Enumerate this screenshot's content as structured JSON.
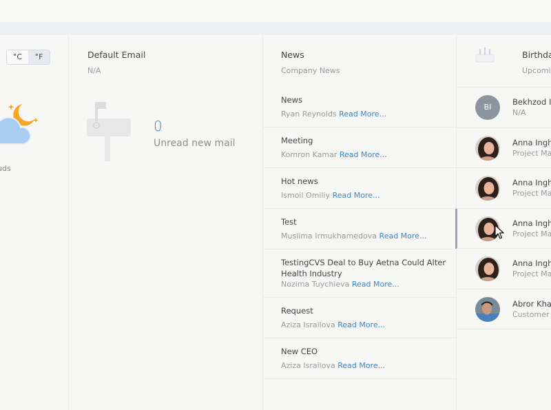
{
  "weather": {
    "units": [
      "°C",
      "°F"
    ],
    "active_unit": "°F",
    "description": "uds",
    "icon": "cloud-moon-icon"
  },
  "email": {
    "title": "Default Email",
    "subtitle": "N/A",
    "count": "0",
    "count_label": "Unread new mail",
    "icon": "mailbox-icon"
  },
  "news": {
    "title": "News",
    "subtitle": "Company News",
    "read_more": "Read More...",
    "items": [
      {
        "title": "News",
        "author": "Ryan Reynolds"
      },
      {
        "title": "Meeting",
        "author": "Komron Kamar"
      },
      {
        "title": "Hot news",
        "author": "Ismoil Omiliy"
      },
      {
        "title": "Test",
        "author": "Muslima Irmukhamedova"
      },
      {
        "title": "TestingCVS Deal to Buy Aetna Could Alter Health Industry",
        "author": "Nozima Tuychieva"
      },
      {
        "title": "Request",
        "author": "Aziza Israilova"
      },
      {
        "title": "New CEO",
        "author": "Aziza Israilova"
      }
    ]
  },
  "birthdays": {
    "title": "Birthda",
    "subtitle": "Upcomi",
    "icon": "cake-icon",
    "people": [
      {
        "initials": "BI",
        "name": "Bekhzod Is",
        "role": "N/A"
      },
      {
        "name": "Anna Ingh",
        "role": "Project Mar"
      },
      {
        "name": "Anna Ingh",
        "role": "Project Mar"
      },
      {
        "name": "Anna Ingh",
        "role": "Project Mar"
      },
      {
        "name": "Anna Ingh",
        "role": "Project Mar"
      },
      {
        "name": "Abror Khas",
        "role": "Customer S"
      }
    ]
  }
}
